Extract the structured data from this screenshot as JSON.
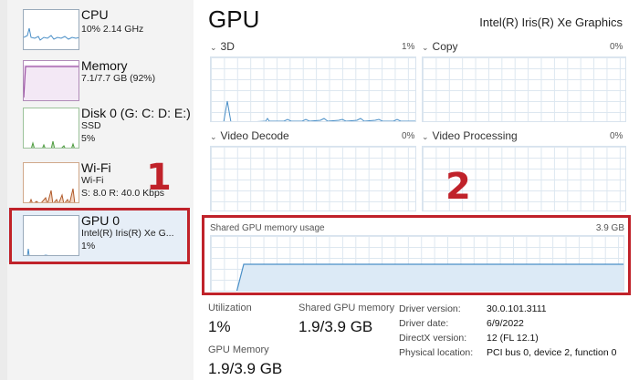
{
  "sidebar": {
    "items": [
      {
        "name": "CPU",
        "line1": "10% 2.14 GHz",
        "line2": "",
        "line3": ""
      },
      {
        "name": "Memory",
        "line1": "7.1/7.7 GB (92%)",
        "line2": "",
        "line3": ""
      },
      {
        "name": "Disk 0 (G: C: D: E:)",
        "line1": "SSD",
        "line2": "5%",
        "line3": ""
      },
      {
        "name": "Wi-Fi",
        "line1": "Wi-Fi",
        "line2": "S: 8.0 R: 40.0 Kbps",
        "line3": ""
      },
      {
        "name": "GPU 0",
        "line1": "Intel(R) Iris(R) Xe G...",
        "line2": "1%",
        "line3": ""
      }
    ]
  },
  "annotations": {
    "callout1": "1",
    "callout2": "2"
  },
  "main": {
    "title": "GPU",
    "adapter_name": "Intel(R) Iris(R) Xe Graphics",
    "engines": [
      {
        "label": "3D",
        "percent": "1%"
      },
      {
        "label": "Copy",
        "percent": "0%"
      },
      {
        "label": "Video Decode",
        "percent": "0%"
      },
      {
        "label": "Video Processing",
        "percent": "0%"
      }
    ],
    "shared_graph": {
      "label": "Shared GPU memory usage",
      "max": "3.9 GB"
    },
    "stats": {
      "utilization_label": "Utilization",
      "utilization_value": "1%",
      "shared_mem_label": "Shared GPU memory",
      "shared_mem_value": "1.9/3.9 GB",
      "gpu_mem_label": "GPU Memory",
      "gpu_mem_value": "1.9/3.9 GB"
    },
    "details": [
      {
        "key": "Driver version:",
        "value": "30.0.101.3111"
      },
      {
        "key": "Driver date:",
        "value": "6/9/2022"
      },
      {
        "key": "DirectX version:",
        "value": "12 (FL 12.1)"
      },
      {
        "key": "Physical location:",
        "value": "PCI bus 0, device 2, function 0"
      }
    ]
  },
  "colors": {
    "accent": "#4a8fc7",
    "memory_accent": "#9b4ea3",
    "disk_accent": "#4d9b3f",
    "wifi_accent": "#b05a2a",
    "annotation_red": "#c0222a"
  }
}
